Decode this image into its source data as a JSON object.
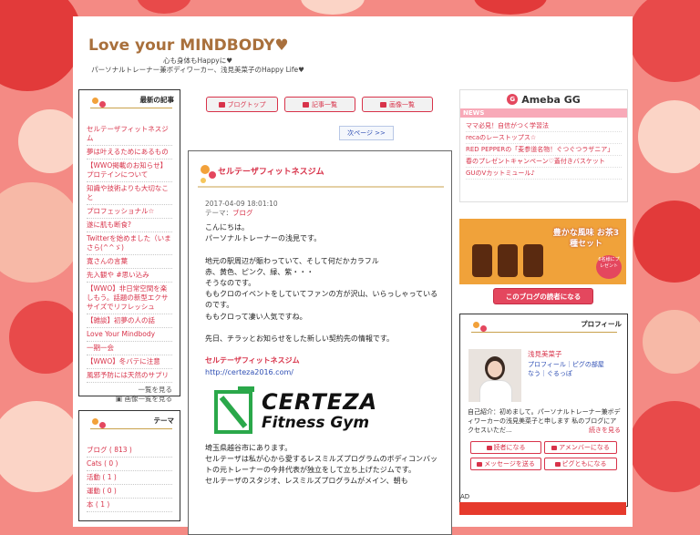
{
  "blog": {
    "title": "Love your MINDBODY♥",
    "subtitle_line1": "心も身体もHappyに♥",
    "subtitle_line2": "パーソナルトレーナー兼ボディワーカー、浅見美菜子のHappy Life♥"
  },
  "recent": {
    "heading": "最新の記事",
    "items": [
      "セルテーザフィットネスジム",
      "夢は叶えるためにあるもの",
      "【WWO掲載のお知らせ】プロテインについて",
      "知識や技術よりも大切なこと",
      "プロフェッショナル☆",
      "遂に肌も断食?",
      "Twitterを始めました（いまさら(^^ゞ)",
      "寛さんの言葉",
      "先入観や #思い込み",
      "【WWO】非日常空間を楽しもう。話題の新型エクササイズでリフレッシュ",
      "【雑談】初夢の人の話",
      "Love Your Mindbody",
      "一期一会",
      "【WWO】冬バテに注意",
      "風邪予防には天然のサプリ"
    ],
    "more_link": "一覧を見る",
    "image_link": "画像一覧を見る"
  },
  "themes": {
    "heading": "テーマ",
    "items": [
      "ブログ ( 813 )",
      "Cats ( 0 )",
      "活動 ( 1 )",
      "運動 ( 0 )",
      "本 ( 1 )"
    ]
  },
  "nav": {
    "blog_top": "ブログトップ",
    "articles": "記事一覧",
    "images": "画像一覧",
    "next_page": "次ページ >>"
  },
  "article": {
    "title": "セルテーザフィットネスジム",
    "date": "2017-04-09 18:01:10",
    "theme_label": "テーマ：",
    "theme_link": "ブログ",
    "paragraphs": [
      "こんにちは。",
      "パーソナルトレーナーの浅見です。",
      "",
      "地元の駅周辺が賑わっていて、そして何だかカラフル",
      "赤、黄色、ピンク、緑、紫・・・",
      "そうなのです。",
      "ももクロのイベントをしていてファンの方が沢山、いらっしゃっているのです。",
      "ももクロって凄い人気ですね。",
      "",
      "先日、チラッとお知らせをした新しい契約先の情報です。",
      ""
    ],
    "gym_name": "セルテーザフィットネスジム",
    "gym_url": "http://certeza2016.com/",
    "logo_word1": "CERTEZA",
    "logo_word2": "Fitness Gym",
    "after_logo": [
      "埼玉県越谷市にあります。",
      "セルテーザは私が心から愛するレスミルズプログラムのボディコンバットの元トレーナーの今井代表が独立をして立ち上げたジムです。",
      "セルテーザのスタジオ、レスミルズプログラムがメイン、朝も"
    ]
  },
  "ameba": {
    "logo": "Ameba GG",
    "news_label": "NEWS",
    "news": [
      "ママ必見！自信がつく学習法",
      "recaのレーストップス☆",
      "RED PEPPERの「麦参道名物！ぐつぐつラザニア」",
      "春のプレゼントキャンペーン♡蓋付きバスケット",
      "GUのVカットミュール♪"
    ]
  },
  "ad_banner": {
    "caption": "豊かな風味 お茶3種セット",
    "badge": "6名様にプレゼント"
  },
  "reader_button": "このブログの読者になる",
  "profile": {
    "heading": "プロフィール",
    "name": "浅見美菜子",
    "links": "プロフィール｜ピグの部屋\nなう｜ぐるっぽ",
    "intro": "自己紹介：初めまして。パーソナルトレーナー兼ボディワーカーの浅見美菜子と申します 私のブログにアクセスいただ...",
    "continue": "続きを見る",
    "btn_reader": "読者になる",
    "btn_amember": "アメンバーになる",
    "btn_message": "メッセージを送る",
    "btn_pigg": "ピグともになる"
  },
  "ad_label": "AD",
  "colors": {
    "accent": "#d8334a",
    "title_brown": "#a9703c",
    "link_blue": "#2f4fb4",
    "background": "#f48a84"
  }
}
